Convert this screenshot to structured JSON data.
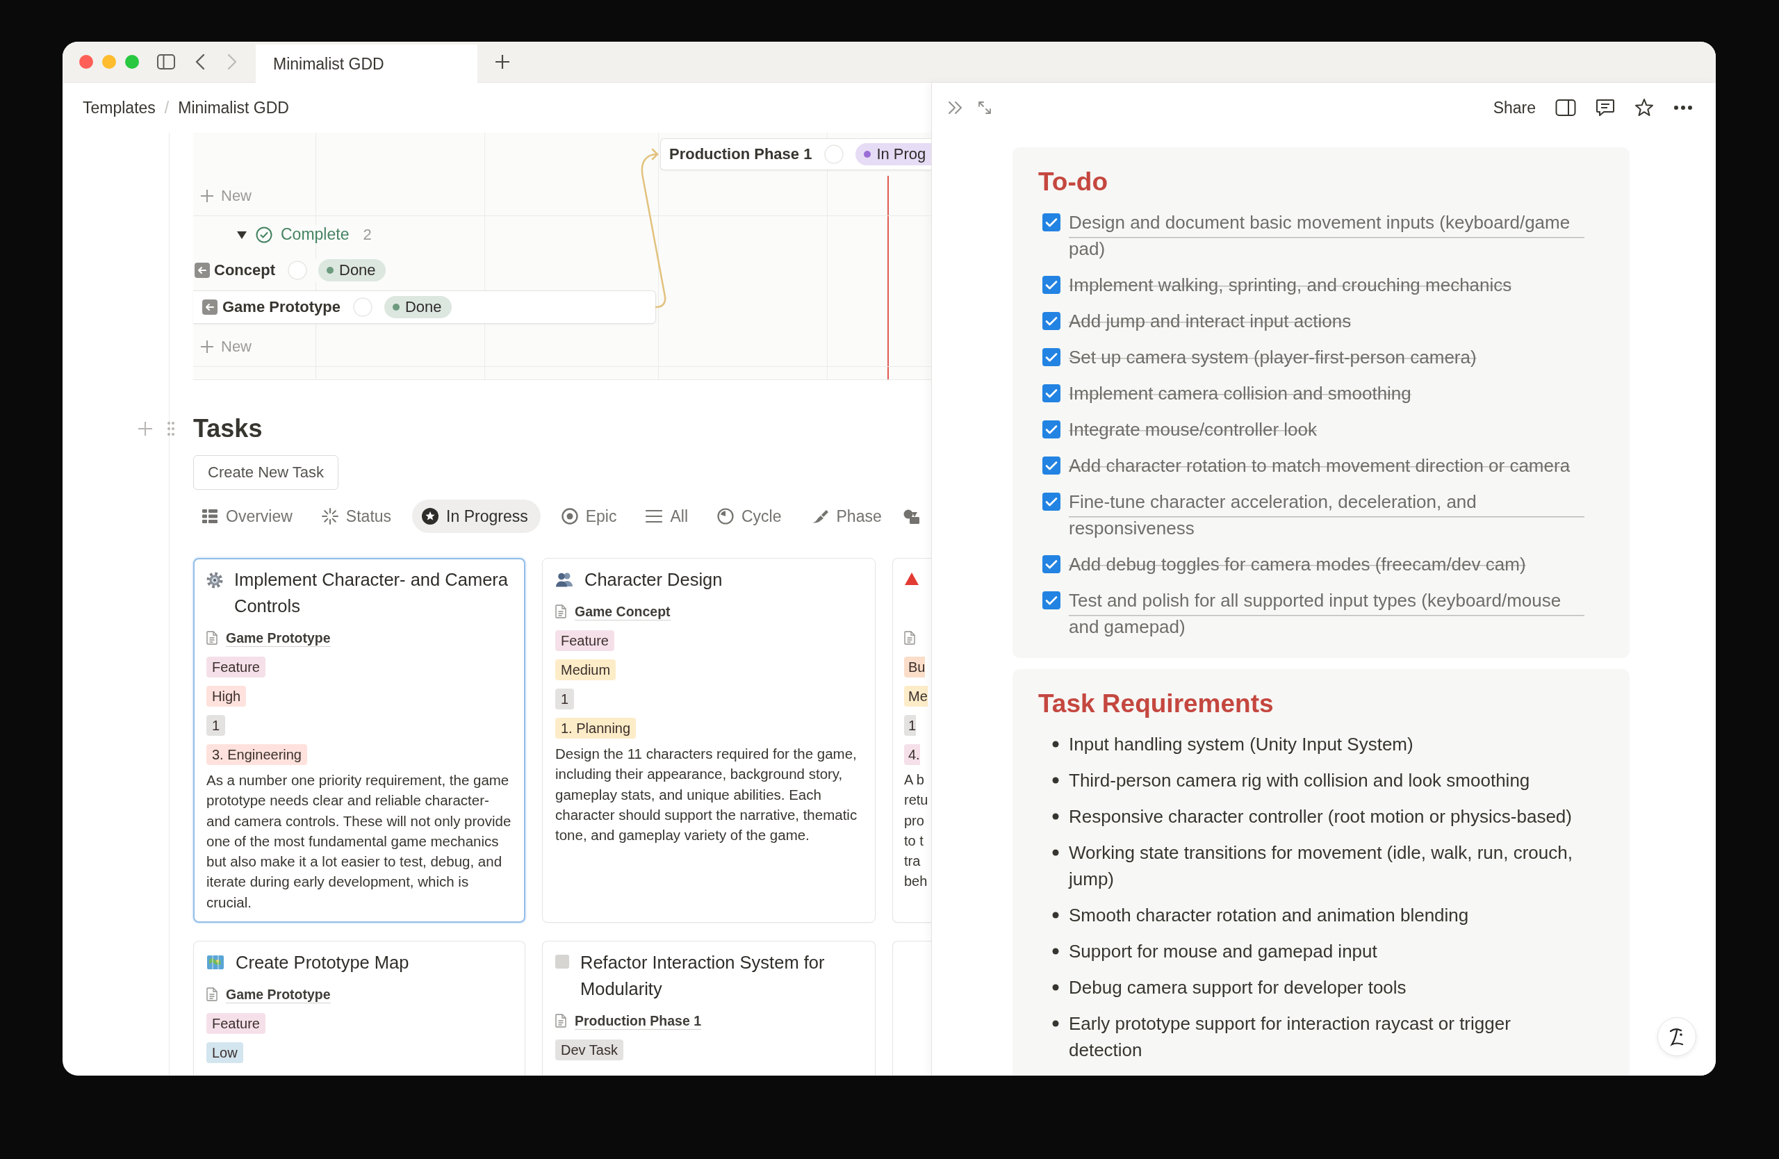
{
  "titlebar": {
    "tabs": [
      {
        "label": "Minimalist GDD",
        "selected": true
      }
    ],
    "back": {
      "disabled": false
    },
    "forward": {
      "disabled": true
    }
  },
  "breadcrumb": {
    "items": [
      "Templates",
      "Minimalist GDD"
    ],
    "separator": "/"
  },
  "timeline": {
    "rows": [
      {
        "kind": "start",
        "label": "Production Phase 1",
        "status": {
          "label": "In Prog",
          "color": "#9a6dd7"
        }
      },
      {
        "kind": "new",
        "label": "New"
      },
      {
        "kind": "group",
        "label": "Complete",
        "count": "2",
        "expanded": true,
        "children": [
          {
            "kind": "label",
            "label": "Concept",
            "status": {
              "label": "Done",
              "color": "#6c9b7d"
            }
          },
          {
            "kind": "bar",
            "label": "Game Prototype",
            "status": {
              "label": "Done",
              "color": "#6c9b7d"
            }
          }
        ]
      },
      {
        "kind": "new",
        "label": "New"
      }
    ]
  },
  "tasks": {
    "title": "Tasks",
    "create_button": "Create New Task",
    "views": [
      {
        "label": "Overview",
        "selected": false
      },
      {
        "label": "Status",
        "selected": false
      },
      {
        "label": "In Progress",
        "selected": true
      },
      {
        "label": "Epic",
        "selected": false
      },
      {
        "label": "All",
        "selected": false
      },
      {
        "label": "Cycle",
        "selected": false
      },
      {
        "label": "Phase",
        "selected": false
      }
    ],
    "card_rows": [
      [
        {
          "kind": "full",
          "selected": true,
          "title": "Implement Character- and Camera Controls",
          "page": "Game Prototype",
          "tags": [
            {
              "label": "Feature",
              "color": "#f5e0e9"
            },
            {
              "label": "High",
              "color": "#ffe2dd"
            },
            {
              "label": "1",
              "color": "#e3e2e0"
            },
            {
              "label": "3. Engineering",
              "color": "#ffe2dd"
            }
          ],
          "description": "As a number one priority requirement, the game prototype needs clear and reliable character- and camera controls. These will not only provide one of the most fundamental game mechanics but also make it a lot easier to test, debug, and iterate during early development, which is crucial."
        },
        {
          "kind": "full",
          "selected": false,
          "title": "Character Design",
          "page": "Game Concept",
          "tags": [
            {
              "label": "Feature",
              "color": "#f5e0e9"
            },
            {
              "label": "Medium",
              "color": "#fdecc8"
            },
            {
              "label": "1",
              "color": "#e3e2e0"
            },
            {
              "label": "1. Planning",
              "color": "#fdecc8"
            }
          ],
          "description": "Design the 11 characters required for the game, including their appearance, background story, gameplay stats, and unique abilities. Each character should support the narrative, thematic tone, and gameplay variety of the game."
        },
        {
          "kind": "clipped",
          "selected": false,
          "tags": [
            {
              "label": "Bu",
              "color": "#fadec9"
            },
            {
              "label": "Me",
              "color": "#fdecc8"
            },
            {
              "label": "1",
              "color": "#e3e2e0"
            },
            {
              "label": "4.",
              "color": "#f5e0e9"
            }
          ],
          "description_lines": [
            "A b",
            "retu",
            "pro",
            "to t",
            "tra",
            "beh"
          ]
        }
      ],
      [
        {
          "kind": "full",
          "selected": false,
          "title": "Create Prototype Map",
          "page": "Game Prototype",
          "tags": [
            {
              "label": "Feature",
              "color": "#f5e0e9"
            },
            {
              "label": "Low",
              "color": "#d3e5ef"
            }
          ]
        },
        {
          "kind": "full",
          "selected": false,
          "title": "Refactor Interaction System for Modularity",
          "page": "Production Phase 1",
          "tags": [
            {
              "label": "Dev Task",
              "color": "#e3e2e0"
            }
          ]
        },
        {
          "kind": "clipped",
          "selected": false
        }
      ]
    ]
  },
  "side_peek": {
    "share": "Share",
    "todo": {
      "title": "To-do",
      "items": [
        {
          "text": "Design and document basic movement inputs (keyboard/game pad)",
          "checked": true
        },
        {
          "text": "Implement walking, sprinting, and crouching mechanics",
          "checked": true
        },
        {
          "text": "Add jump and interact input actions",
          "checked": true
        },
        {
          "text": "Set up camera system (player-first-person camera)",
          "checked": true
        },
        {
          "text": "Implement camera collision and smoothing",
          "checked": true
        },
        {
          "text": "Integrate mouse/controller look",
          "checked": true
        },
        {
          "text": "Add character rotation to match movement direction or camera",
          "checked": true
        },
        {
          "text": "Fine-tune character acceleration, deceleration, and responsiveness",
          "checked": true
        },
        {
          "text": "Add debug toggles for camera modes (freecam/dev cam)",
          "checked": true
        },
        {
          "text": "Test and polish for all supported input types (keyboard/mouse and gamepad)",
          "checked": true
        }
      ]
    },
    "requirements": {
      "title": "Task Requirements",
      "items": [
        "Input handling system (Unity Input System)",
        "Third-person camera rig with collision and look smoothing",
        "Responsive character controller (root motion or physics-based)",
        "Working state transitions for movement (idle, walk, run, crouch, jump)",
        "Smooth character rotation and animation blending",
        "Support for mouse and gamepad input",
        "Debug camera support for developer tools",
        "Early prototype support for interaction raycast or trigger\ndetection"
      ]
    }
  }
}
